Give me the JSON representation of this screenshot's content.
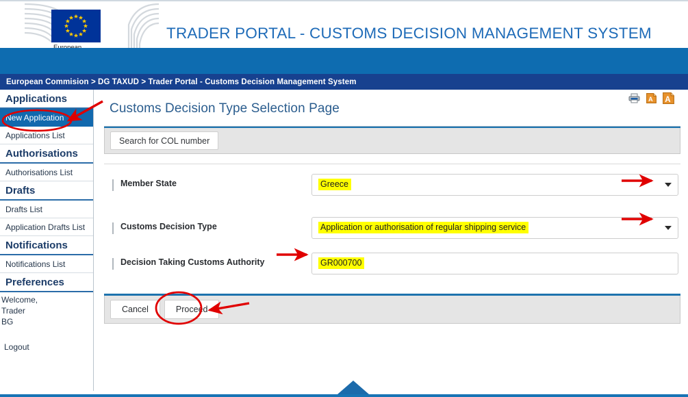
{
  "header": {
    "logo_caption": "European\nCommission",
    "portal_title": "TRADER PORTAL - CUSTOMS DECISION MANAGEMENT SYSTEM",
    "breadcrumb": "European Commision > DG TAXUD > Trader Portal - Customs Decision Management System",
    "brand_blue": "#0e6cb0",
    "breadcrumb_blue": "#17418f",
    "title_blue": "#1e6bb8"
  },
  "toolbar": {
    "print_icon": "printer-icon",
    "font_decrease_icon": "font-size-small-icon",
    "font_increase_icon": "font-size-large-icon",
    "icon_accent": "#e8922c"
  },
  "sidebar": {
    "groups": [
      {
        "heading": "Applications",
        "items": [
          {
            "label": "New Application",
            "active": true
          },
          {
            "label": "Applications List",
            "active": false
          }
        ]
      },
      {
        "heading": "Authorisations",
        "items": [
          {
            "label": "Authorisations List",
            "active": false
          }
        ]
      },
      {
        "heading": "Drafts",
        "items": [
          {
            "label": "Drafts List",
            "active": false
          },
          {
            "label": "Application Drafts List",
            "active": false
          }
        ]
      },
      {
        "heading": "Notifications",
        "items": [
          {
            "label": "Notifications List",
            "active": false
          }
        ]
      },
      {
        "heading": "Preferences",
        "items": []
      }
    ],
    "welcome": "Welcome,\nTrader\nBG",
    "logout": "Logout",
    "active_bg": "#1269ae"
  },
  "main": {
    "page_title": "Customs Decision Type Selection Page",
    "search_button_label": "Search for COL number",
    "fields": [
      {
        "label": "Member State",
        "value": "Greece",
        "has_caret": true,
        "highlight": "#ffff00"
      },
      {
        "label": "Customs Decision Type",
        "value": "Application or authorisation of regular shipping service",
        "has_caret": true,
        "highlight": "#ffff00"
      },
      {
        "label": "Decision Taking Customs Authority",
        "value": "GR000700",
        "has_caret": false,
        "highlight": "#ffff00"
      }
    ],
    "buttons": [
      {
        "label": "Cancel"
      },
      {
        "label": "Proceed"
      }
    ]
  },
  "annotations": {
    "color": "#e00000",
    "items": [
      {
        "name": "ellipse-new-application",
        "shape": "ellipse"
      },
      {
        "name": "arrow-to-new-application",
        "shape": "arrow"
      },
      {
        "name": "arrow-to-member-state-dropdown",
        "shape": "arrow"
      },
      {
        "name": "arrow-to-decision-type-dropdown",
        "shape": "arrow"
      },
      {
        "name": "arrow-to-customs-authority-field",
        "shape": "arrow"
      },
      {
        "name": "ellipse-proceed-button",
        "shape": "ellipse"
      },
      {
        "name": "arrow-to-proceed-button",
        "shape": "arrow"
      }
    ]
  }
}
